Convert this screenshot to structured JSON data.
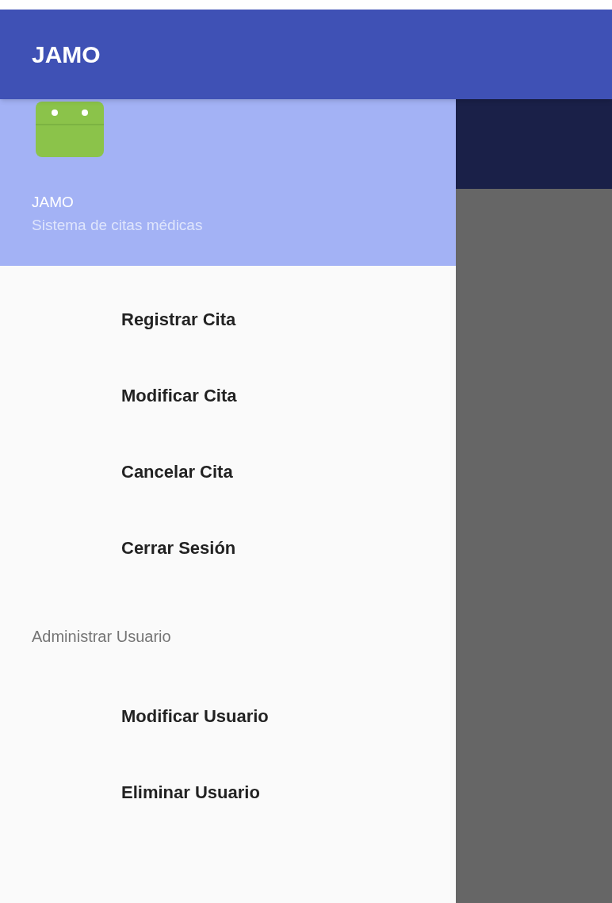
{
  "app_bar": {
    "title": "JAMO"
  },
  "drawer": {
    "header": {
      "title": "JAMO",
      "subtitle": "Sistema de citas médicas"
    },
    "items": [
      {
        "label": "Registrar Cita"
      },
      {
        "label": "Modificar Cita"
      },
      {
        "label": "Cancelar Cita"
      },
      {
        "label": "Cerrar Sesión"
      }
    ],
    "sections": [
      {
        "title": "Administrar Usuario",
        "items": [
          {
            "label": "Modificar Usuario"
          },
          {
            "label": "Eliminar Usuario"
          }
        ]
      }
    ]
  }
}
